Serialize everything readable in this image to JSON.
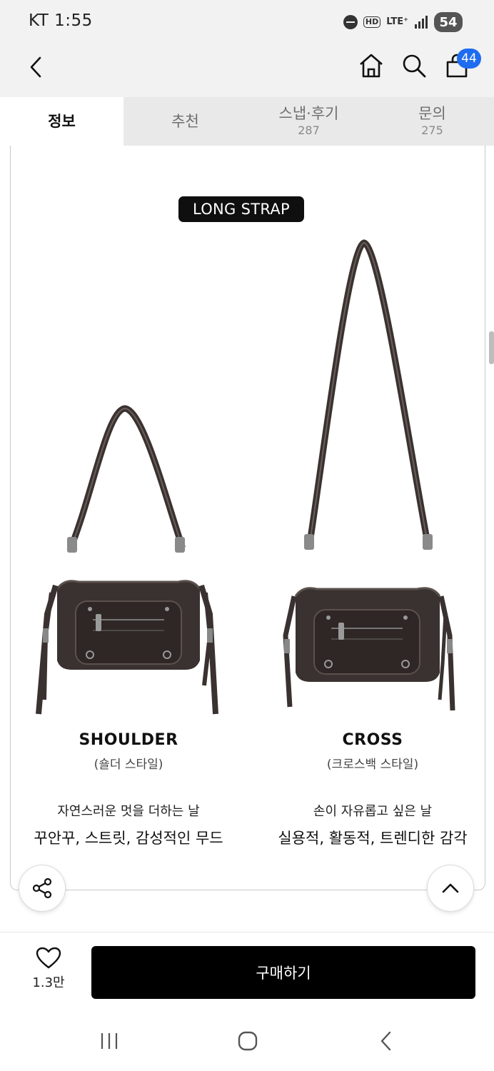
{
  "status": {
    "time": "KT 1:55",
    "hd": "HD",
    "lte": "LTE⁺",
    "battery": "54"
  },
  "header": {
    "cart_count": "44"
  },
  "tabs": [
    {
      "label": "정보",
      "count": ""
    },
    {
      "label": "추천",
      "count": ""
    },
    {
      "label": "스냅·후기",
      "count": "287"
    },
    {
      "label": "문의",
      "count": "275"
    }
  ],
  "content": {
    "badge": "LONG STRAP",
    "shoulder": {
      "title": "SHOULDER",
      "subtitle": "(숄더 스타일)",
      "desc1": "자연스러운 멋을 더하는 날",
      "desc2": "꾸안꾸, 스트릿, 감성적인 무드"
    },
    "cross": {
      "title": "CROSS",
      "subtitle": "(크로스백 스타일)",
      "desc1": "손이 자유롭고 싶은 날",
      "desc2": "실용적, 활동적, 트렌디한 감각"
    }
  },
  "bottom": {
    "like_count": "1.3만",
    "buy_label": "구매하기"
  },
  "colors": {
    "accent": "#1e6cf0",
    "buy_button": "#000000",
    "bag": "#3a3230"
  }
}
